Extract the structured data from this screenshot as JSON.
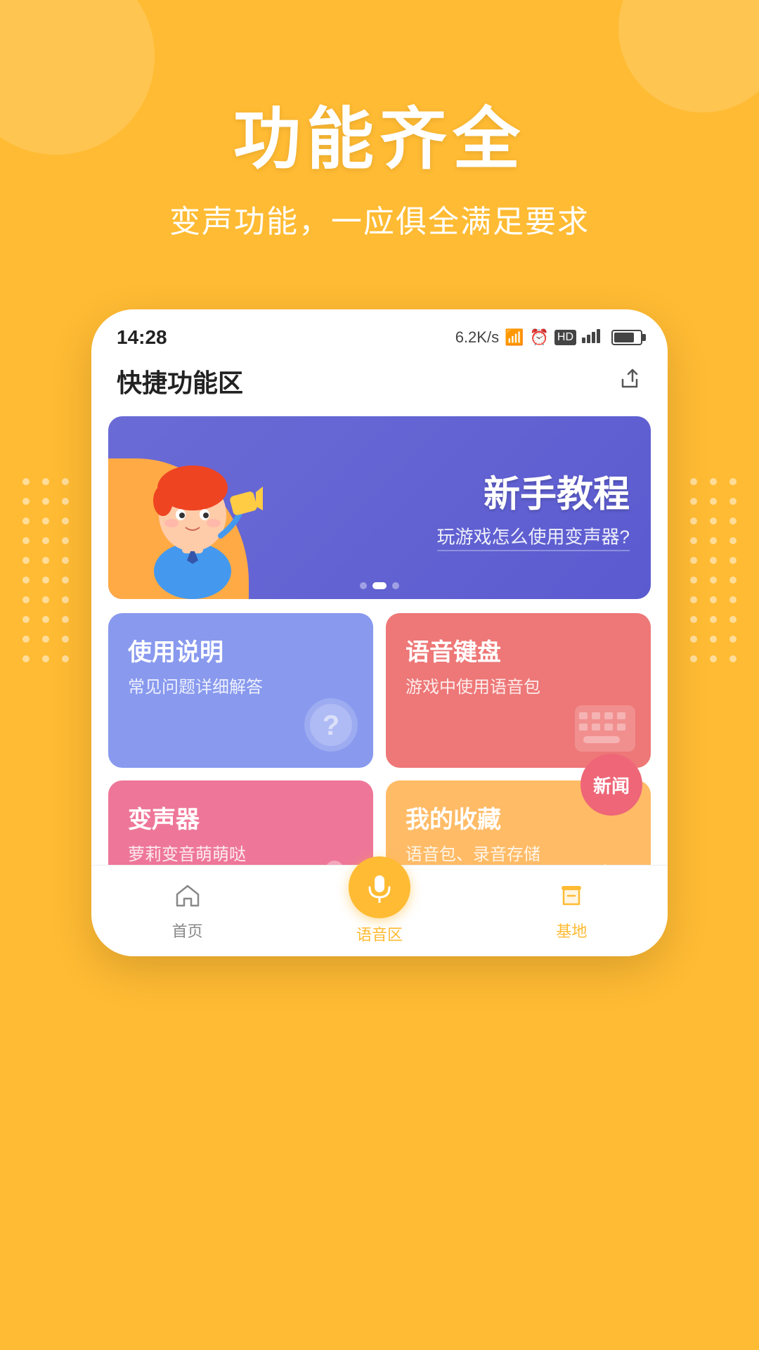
{
  "background_color": "#FFBB33",
  "hero": {
    "title": "功能齐全",
    "subtitle": "变声功能，一应俱全满足要求"
  },
  "phone": {
    "status_bar": {
      "time": "14:28",
      "right_info": "6.2K/s ✦ ⏰ HD 4G"
    },
    "page_title": "快捷功能区",
    "banner": {
      "title": "新手教程",
      "subtitle": "玩游戏怎么使用变声器?"
    },
    "cards": [
      {
        "id": "usage",
        "title": "使用说明",
        "subtitle": "常见问题详细解答",
        "color": "blue",
        "icon": "question"
      },
      {
        "id": "voice-keyboard",
        "title": "语音键盘",
        "subtitle": "游戏中使用语音包",
        "color": "pink-red",
        "icon": "keyboard"
      },
      {
        "id": "voice-changer",
        "title": "变声器",
        "subtitle": "萝莉变音萌萌哒",
        "color": "pink",
        "icon": "microphone"
      },
      {
        "id": "favorites",
        "title": "我的收藏",
        "subtitle": "语音包、录音存储",
        "color": "orange",
        "icon": "box"
      }
    ],
    "news_badge": "新闻",
    "bottom_nav": [
      {
        "id": "home",
        "label": "首页",
        "icon": "home"
      },
      {
        "id": "voice-zone",
        "label": "语音区",
        "icon": "mic",
        "center": true
      },
      {
        "id": "base",
        "label": "基地",
        "icon": "base"
      }
    ]
  }
}
